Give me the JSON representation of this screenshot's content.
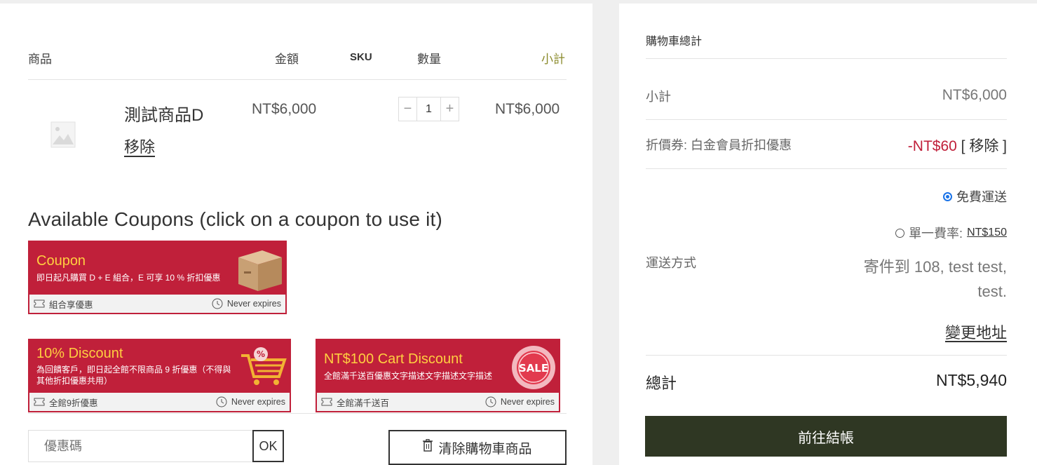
{
  "cart": {
    "headers": {
      "product": "商品",
      "price": "金額",
      "sku": "SKU",
      "quantity": "數量",
      "subtotal": "小計"
    },
    "items": [
      {
        "name": "測試商品D",
        "remove_label": "移除",
        "price": "NT$6,000",
        "quantity": "1",
        "subtotal": "NT$6,000",
        "thumbnail_icon": "image-placeholder-icon"
      }
    ],
    "qty_minus": "−",
    "qty_plus": "+"
  },
  "coupons": {
    "heading": "Available Coupons (click on a coupon to use it)",
    "list": [
      {
        "title": "Coupon",
        "description": "即日起凡購買 D + E 組合，E 可享 10 % 折扣優惠",
        "tag": "組合享優惠",
        "expiry": "Never expires",
        "art_icon": "box-icon"
      },
      {
        "title": "10% Discount",
        "description": "為回饋客戶，即日起全館不限商品 9 折優惠（不得與其他折扣優惠共用）",
        "tag": "全館9折優惠",
        "expiry": "Never expires",
        "art_icon": "cart-percent-icon"
      },
      {
        "title": "NT$100 Cart Discount",
        "description": "全館滿千送百優惠文字描述文字描述文字描述",
        "tag": "全館滿千送百",
        "expiry": "Never expires",
        "art_icon": "sale-badge-icon",
        "art_text": "SALE"
      }
    ],
    "code_placeholder": "優惠碼",
    "ok_label": "OK",
    "clear_cart_label": "清除購物車商品",
    "colors": {
      "coupon_bg": "#c0203a",
      "coupon_title": "#ffcf40"
    }
  },
  "totals": {
    "title": "購物車總計",
    "subtotal_label": "小計",
    "subtotal_value": "NT$6,000",
    "coupon_label": "折價券: 白金會員折扣優惠",
    "coupon_value": "-NT$60",
    "coupon_remove": "[ 移除 ]",
    "shipping_label": "運送方式",
    "shipping_options": [
      {
        "label": "免費運送",
        "selected": true
      },
      {
        "label": "單一費率:",
        "price": "NT$150",
        "selected": false
      }
    ],
    "ship_to": "寄件到 108, test test, test.",
    "change_address": "變更地址",
    "total_label": "總計",
    "total_value": "NT$5,940",
    "checkout_label": "前往結帳",
    "checkout_color": "#2f3723"
  }
}
